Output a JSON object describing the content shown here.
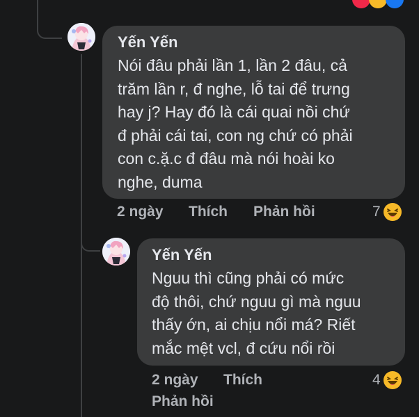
{
  "comments": [
    {
      "name": "Yến Yến",
      "text": "Nói đâu phải lần 1, lần 2 đâu, cả\ntrăm lần r, đ nghe, lỗ tai để trưng\nhay j? Hay đó là cái quai nồi chứ\nđ phải cái tai, con ng chứ có phải\ncon c.ặ.c đ đâu mà nói hoài ko\nnghe, duma",
      "time": "2 ngày",
      "like": "Thích",
      "reply": "Phản hồi",
      "reaction_count": "7",
      "reaction_icon": "haha-emoji-icon"
    },
    {
      "name": "Yến Yến",
      "text": "Nguu thì cũng phải có mức\nđộ thôi, chứ nguu gì mà nguu\nthấy ớn, ai chịu nổi má? Riết\nmắc mệt vcl, đ cứu nổi rồi",
      "time": "2 ngày",
      "like": "Thích",
      "reply": "Phản hồi",
      "reaction_count": "4",
      "reaction_icon": "haha-emoji-icon"
    }
  ],
  "colors": {
    "background": "#18191a",
    "bubble": "#3a3b3c",
    "text": "#e4e6eb",
    "secondary": "#b0b3b8",
    "thread_line": "#3e4042",
    "haha": "#f7b928"
  }
}
